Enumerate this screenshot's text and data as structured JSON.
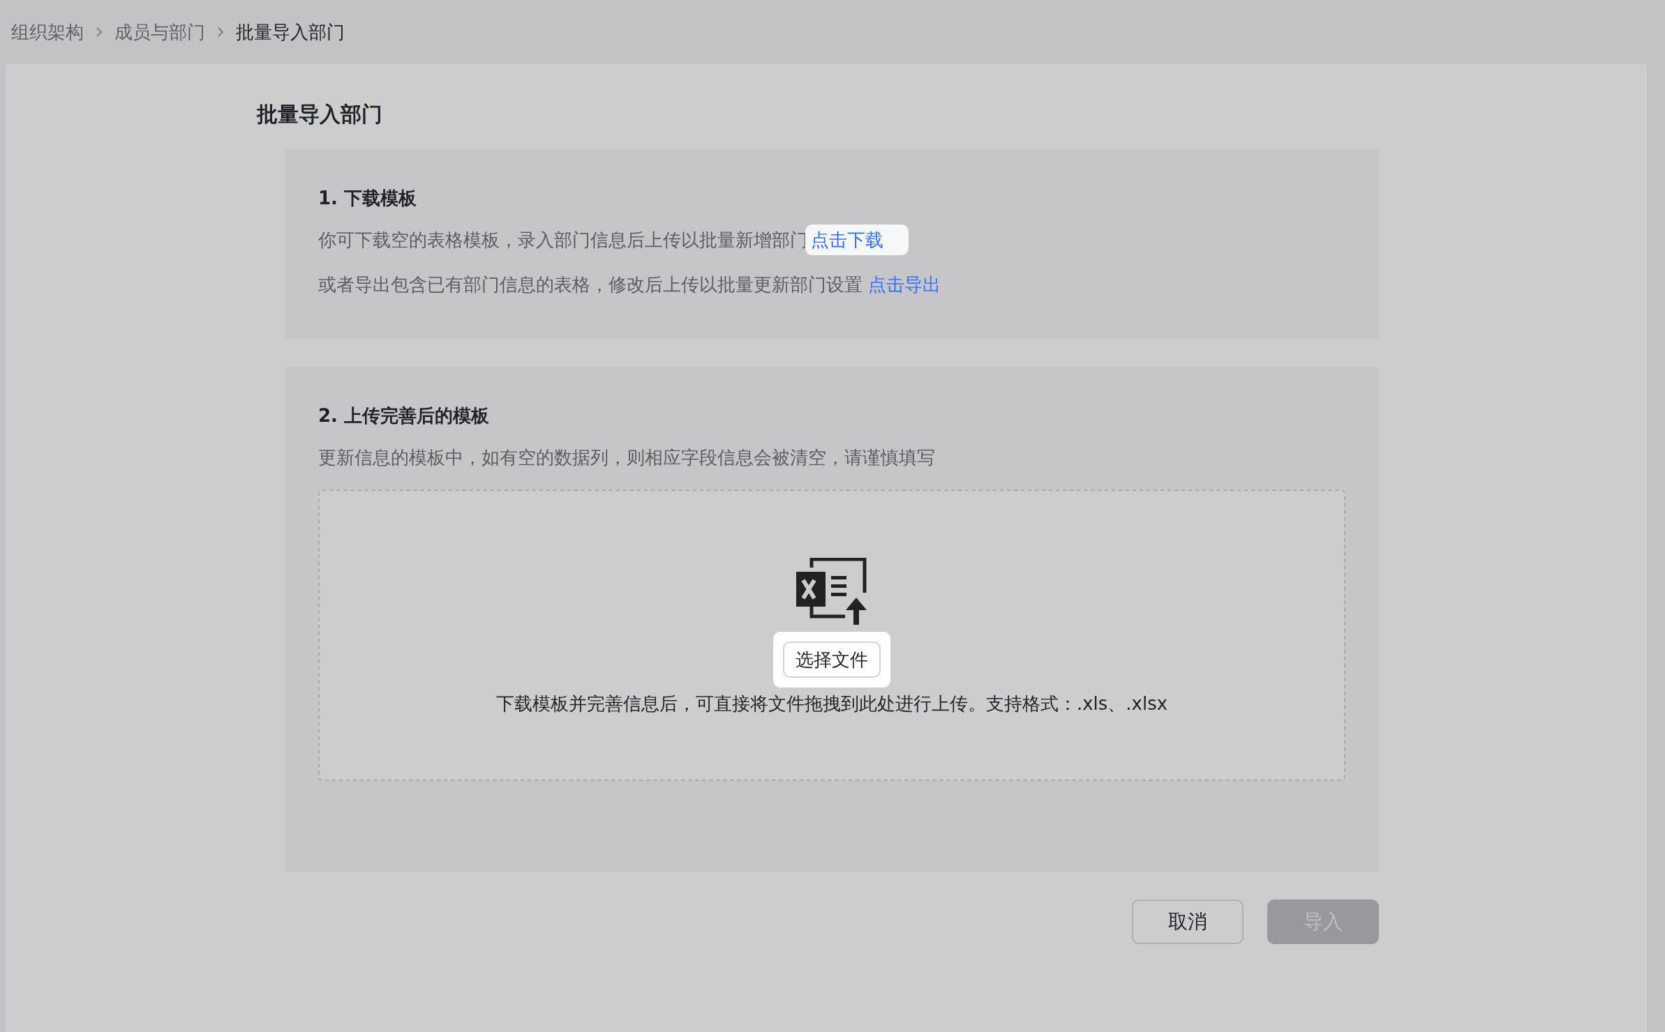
{
  "breadcrumb": [
    {
      "label": "组织架构",
      "current": false
    },
    {
      "label": "成员与部门",
      "current": false
    },
    {
      "label": "批量导入部门",
      "current": true
    }
  ],
  "page_title": "批量导入部门",
  "step1": {
    "title": "1. 下载模板",
    "lines": [
      {
        "text": "你可下载空的表格模板，录入部门信息后上传以批量新增部门",
        "link": "点击下载",
        "highlighted": true
      },
      {
        "text": "或者导出包含已有部门信息的表格，修改后上传以批量更新部门设置",
        "link": "点击导出",
        "highlighted": false
      }
    ]
  },
  "step2": {
    "title": "2. 上传完善后的模板",
    "note": "更新信息的模板中，如有空的数据列，则相应字段信息会被清空，请谨慎填写",
    "upload": {
      "button": "选择文件",
      "highlighted": true,
      "hint": "下载模板并完善信息后，可直接将文件拖拽到此处进行上传。支持格式：.xls、.xlsx"
    }
  },
  "footer": {
    "buttons": [
      {
        "label": "取消",
        "kind": "secondary",
        "disabled": false
      },
      {
        "label": "导入",
        "kind": "primary",
        "disabled": true
      }
    ]
  }
}
